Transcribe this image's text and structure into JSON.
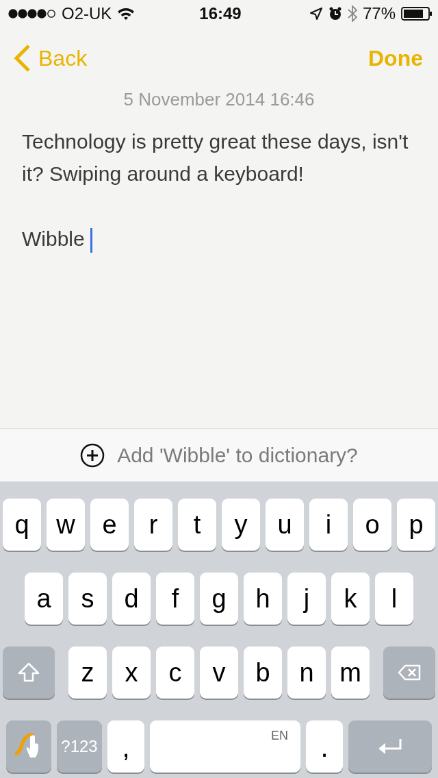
{
  "status_bar": {
    "carrier": "O2-UK",
    "time": "16:49",
    "battery": "77%"
  },
  "nav": {
    "back": "Back",
    "done": "Done"
  },
  "note": {
    "date": "5 November 2014 16:46",
    "paragraphs": [
      "Technology is pretty great these days, isn't it? Swiping around a keyboard!",
      "Wibble"
    ]
  },
  "suggestion": {
    "text": "Add 'Wibble' to dictionary?"
  },
  "keyboard": {
    "rows": [
      [
        {
          "kind": "letter",
          "label": "q"
        },
        {
          "kind": "letter",
          "label": "w"
        },
        {
          "kind": "letter",
          "label": "e"
        },
        {
          "kind": "letter",
          "label": "r"
        },
        {
          "kind": "letter",
          "label": "t"
        },
        {
          "kind": "letter",
          "label": "y"
        },
        {
          "kind": "letter",
          "label": "u"
        },
        {
          "kind": "letter",
          "label": "i"
        },
        {
          "kind": "letter",
          "label": "o"
        },
        {
          "kind": "letter",
          "label": "p"
        }
      ],
      [
        {
          "kind": "letter",
          "label": "a"
        },
        {
          "kind": "letter",
          "label": "s"
        },
        {
          "kind": "letter",
          "label": "d"
        },
        {
          "kind": "letter",
          "label": "f"
        },
        {
          "kind": "letter",
          "label": "g"
        },
        {
          "kind": "letter",
          "label": "h"
        },
        {
          "kind": "letter",
          "label": "j"
        },
        {
          "kind": "letter",
          "label": "k"
        },
        {
          "kind": "letter",
          "label": "l"
        }
      ],
      [
        {
          "kind": "shift"
        },
        {
          "kind": "letter",
          "label": "z"
        },
        {
          "kind": "letter",
          "label": "x"
        },
        {
          "kind": "letter",
          "label": "c"
        },
        {
          "kind": "letter",
          "label": "v"
        },
        {
          "kind": "letter",
          "label": "b"
        },
        {
          "kind": "letter",
          "label": "n"
        },
        {
          "kind": "letter",
          "label": "m"
        },
        {
          "kind": "backspace"
        }
      ],
      [
        {
          "kind": "swype"
        },
        {
          "kind": "numbers",
          "label": "?123"
        },
        {
          "kind": "punct",
          "label": ","
        },
        {
          "kind": "space",
          "label": "EN"
        },
        {
          "kind": "punct",
          "label": "."
        },
        {
          "kind": "return"
        }
      ]
    ]
  }
}
